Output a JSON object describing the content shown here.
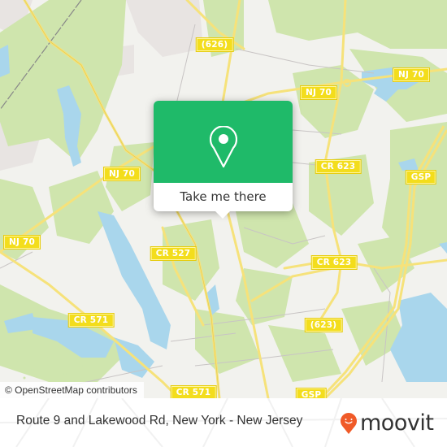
{
  "map": {
    "colors": {
      "land": "#f2f2ee",
      "park": "#cfe5ad",
      "residential": "#e8e4e2",
      "water": "#a9d6ec",
      "road_major": "#f6e27a",
      "road_minor": "#c8c4c4",
      "railway": "#888888"
    },
    "road_labels": [
      {
        "id": "label-626-north",
        "text": "(626)"
      },
      {
        "id": "label-nj70-east-1",
        "text": "NJ 70"
      },
      {
        "id": "label-nj70-east-2",
        "text": "NJ 70"
      },
      {
        "id": "label-nj70-central",
        "text": "NJ 70"
      },
      {
        "id": "label-nj70-west",
        "text": "NJ 70"
      },
      {
        "id": "label-cr623-north",
        "text": "CR 623"
      },
      {
        "id": "label-gsp-north",
        "text": "GSP"
      },
      {
        "id": "label-cr527",
        "text": "CR 527"
      },
      {
        "id": "label-cr623-south",
        "text": "CR 623"
      },
      {
        "id": "label-cr571-west",
        "text": "CR 571"
      },
      {
        "id": "label-623-south",
        "text": "(623)"
      },
      {
        "id": "label-cr571-south",
        "text": "CR 571"
      },
      {
        "id": "label-gsp-south",
        "text": "GSP"
      }
    ],
    "attribution": "© OpenStreetMap contributors"
  },
  "popup": {
    "icon": "location-pin-icon",
    "button_label": "Take me there",
    "color": "#1fba69"
  },
  "footer": {
    "title": "Route 9 and Lakewood Rd, New York - New Jersey",
    "logo_text": "moovit",
    "logo_color": "#f05a28"
  }
}
